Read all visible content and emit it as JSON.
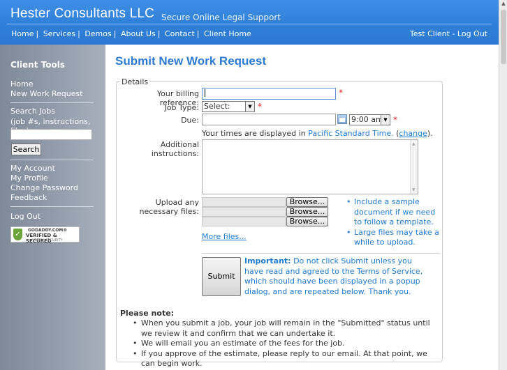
{
  "header": {
    "brand": "Hester Consultants LLC",
    "tagline": "Secure Online Legal Support",
    "nav": [
      "Home",
      "Services",
      "Demos",
      "About Us",
      "Contact",
      "Client Home"
    ],
    "user_label": "Test Client",
    "logout_label": "Log Out"
  },
  "sidebar": {
    "title": "Client Tools",
    "links_top": [
      "Home",
      "New Work Request"
    ],
    "search_title": "Search Jobs",
    "search_hint": "(job #s, instructions, files):",
    "search_button": "Search",
    "account_links": [
      "My Account",
      "My Profile",
      "Change Password",
      "Feedback"
    ],
    "logout": "Log Out",
    "badge": {
      "line1": "GODADDY.COM®",
      "line2": "VERIFIED & SECURED",
      "line3": "VERIFY SECURITY"
    }
  },
  "main": {
    "title": "Submit New Work Request",
    "legend": "Details",
    "billing_label": "Your billing reference:",
    "billing_value": "",
    "jobtype_label": "Job Type:",
    "jobtype_value": "Select:",
    "due_label": "Due:",
    "due_date_value": "",
    "due_time_value": "9:00 am",
    "tz_prefix": "Your times are displayed in ",
    "tz_name": "Pacific Standard Time.",
    "tz_open": " (",
    "tz_change": "change",
    "tz_close": ").",
    "instructions_label": "Additional instructions:",
    "upload_label_1": "Upload any",
    "upload_label_2": "necessary files:",
    "browse_label": "Browse...",
    "tips": [
      "Include a sample document if we need to follow a template.",
      "Large files may take a while to upload."
    ],
    "more_files": "More files...",
    "submit_label": "Submit",
    "important_bold": "Important:",
    "important_text": " Do not click Submit unless you have read and agreed to the Terms of Service, which should have been displayed in a popup dialog, and are repeated below. Thank you.",
    "note_title": "Please note:",
    "notes": [
      "When you submit a job, your job will remain in the \"Submitted\" status until we review it and confirm that we can undertake it.",
      "We will email you an estimate of the fees for the job.",
      "If you approve of the estimate, please reply to our email. At that point, we can begin work."
    ]
  }
}
